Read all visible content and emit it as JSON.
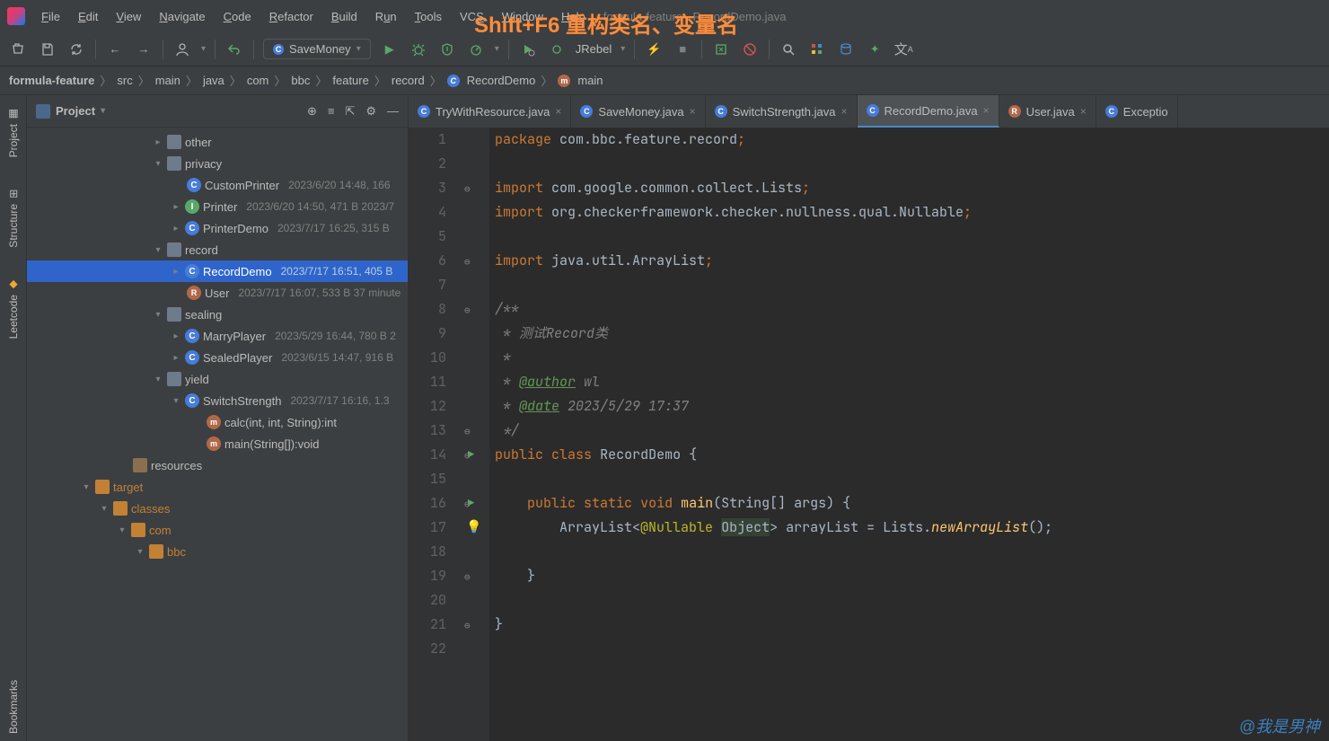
{
  "overlay": "Shift+F6  重构类名、变量名",
  "menubar": {
    "items": [
      "File",
      "Edit",
      "View",
      "Navigate",
      "Code",
      "Refactor",
      "Build",
      "Run",
      "Tools",
      "VCS",
      "Window",
      "Help"
    ],
    "tail": "formula-feature - RecordDemo.java"
  },
  "toolbar": {
    "run_config": "SaveMoney",
    "jrebel": "JRebel"
  },
  "breadcrumb": [
    "formula-feature",
    "src",
    "main",
    "java",
    "com",
    "bbc",
    "feature",
    "record",
    "RecordDemo",
    "main"
  ],
  "panel": {
    "title": "Project"
  },
  "tree": {
    "other": "other",
    "privacy": "privacy",
    "custom_printer": {
      "name": "CustomPrinter",
      "meta": "2023/6/20 14:48, 166"
    },
    "printer": {
      "name": "Printer",
      "meta": "2023/6/20 14:50, 471 B 2023/7"
    },
    "printer_demo": {
      "name": "PrinterDemo",
      "meta": "2023/7/17 16:25, 315 B"
    },
    "record": "record",
    "record_demo": {
      "name": "RecordDemo",
      "meta": "2023/7/17 16:51, 405 B"
    },
    "user": {
      "name": "User",
      "meta": "2023/7/17 16:07, 533 B 37 minute"
    },
    "sealing": "sealing",
    "marry_player": {
      "name": "MarryPlayer",
      "meta": "2023/5/29 16:44, 780 B 2"
    },
    "sealed_player": {
      "name": "SealedPlayer",
      "meta": "2023/6/15 14:47, 916 B"
    },
    "yield": "yield",
    "switch_strength": {
      "name": "SwitchStrength",
      "meta": "2023/7/17 16:16, 1.3"
    },
    "calc": "calc(int, int, String):int",
    "main_m": "main(String[]):void",
    "resources": "resources",
    "target": "target",
    "classes": "classes",
    "com": "com",
    "bbc": "bbc"
  },
  "tabs": [
    {
      "icon": "C",
      "name": "TryWithResource.java"
    },
    {
      "icon": "C",
      "name": "SaveMoney.java"
    },
    {
      "icon": "C",
      "name": "SwitchStrength.java"
    },
    {
      "icon": "R",
      "name": "RecordDemo.java",
      "active": true
    },
    {
      "icon": "R",
      "name": "User.java"
    },
    {
      "icon": "C",
      "name": "Exceptio"
    }
  ],
  "code": {
    "lines": 22,
    "l1": {
      "kw": "package",
      "rest": " com.bbc.feature.record"
    },
    "l3": {
      "kw": "import",
      "rest": " com.google.common.collect.Lists"
    },
    "l4": {
      "kw": "import",
      "rest": " org.checkerframework.checker.nullness.qual.",
      "cls": "Nullable"
    },
    "l6": {
      "kw": "import",
      "rest": " java.util.ArrayList"
    },
    "l8": "/**",
    "l9": " * 测试Record类",
    "l10": " *",
    "l11": {
      "pre": " * ",
      "tag": "@author",
      "rest": " wl"
    },
    "l12": {
      "pre": " * ",
      "tag": "@date",
      "rest": " 2023/5/29 17:37"
    },
    "l13": " */",
    "l14": {
      "kw1": "public",
      "kw2": "class",
      "name": "RecordDemo"
    },
    "l16": {
      "kw1": "public",
      "kw2": "static",
      "kw3": "void",
      "name": "main",
      "args": "(String[] args) {"
    },
    "l17": {
      "type": "ArrayList",
      "an": "@Nullable",
      "obj": "Object",
      "var": "arrayList",
      "rhs1": "Lists.",
      "rhs2": "newArrayList",
      "rhs3": "();"
    }
  },
  "sidetabs": [
    "Project",
    "Structure",
    "Leetcode",
    "Bookmarks"
  ],
  "watermark": "@我是男神"
}
